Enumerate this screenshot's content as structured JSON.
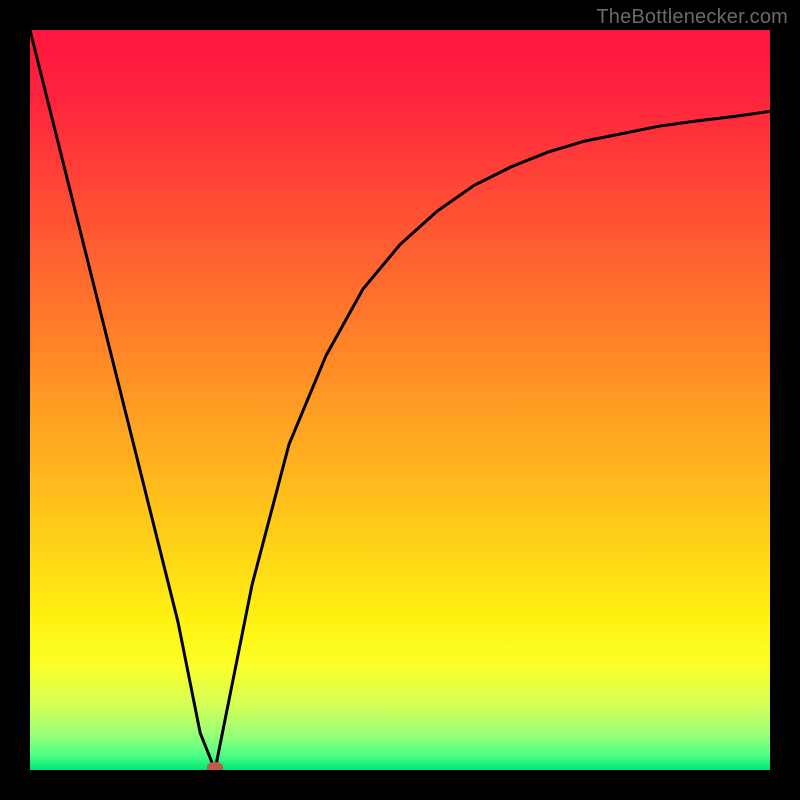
{
  "attribution": "TheBottlenecker.com",
  "chart_data": {
    "type": "line",
    "title": "",
    "xlabel": "",
    "ylabel": "",
    "xlim": [
      0,
      100
    ],
    "ylim": [
      0,
      100
    ],
    "marker": {
      "x": 25,
      "y": 0,
      "color": "#c05a4a"
    },
    "series": [
      {
        "name": "left-branch",
        "x": [
          0,
          5,
          10,
          15,
          20,
          23,
          25
        ],
        "values": [
          100,
          80,
          60,
          40,
          20,
          5,
          0
        ]
      },
      {
        "name": "right-branch",
        "x": [
          25,
          27,
          30,
          35,
          40,
          45,
          50,
          55,
          60,
          65,
          70,
          75,
          80,
          85,
          90,
          95,
          100
        ],
        "values": [
          0,
          10,
          25,
          44,
          56,
          65,
          71,
          75.5,
          79,
          81.5,
          83.5,
          85,
          86,
          87,
          87.7,
          88.3,
          89
        ]
      }
    ],
    "gradient_stops": [
      {
        "pos": 0,
        "color": "#ff163f"
      },
      {
        "pos": 9,
        "color": "#ff233d"
      },
      {
        "pos": 18,
        "color": "#ff3d38"
      },
      {
        "pos": 27,
        "color": "#ff5732"
      },
      {
        "pos": 36,
        "color": "#ff712d"
      },
      {
        "pos": 45,
        "color": "#ff8b27"
      },
      {
        "pos": 54,
        "color": "#ffa521"
      },
      {
        "pos": 63,
        "color": "#ffbf1c"
      },
      {
        "pos": 72,
        "color": "#ffd916"
      },
      {
        "pos": 80,
        "color": "#fff310"
      },
      {
        "pos": 86,
        "color": "#fbff2a"
      },
      {
        "pos": 91,
        "color": "#d7ff54"
      },
      {
        "pos": 95,
        "color": "#9dff77"
      },
      {
        "pos": 98,
        "color": "#4eff84"
      },
      {
        "pos": 100,
        "color": "#00e676"
      }
    ]
  }
}
